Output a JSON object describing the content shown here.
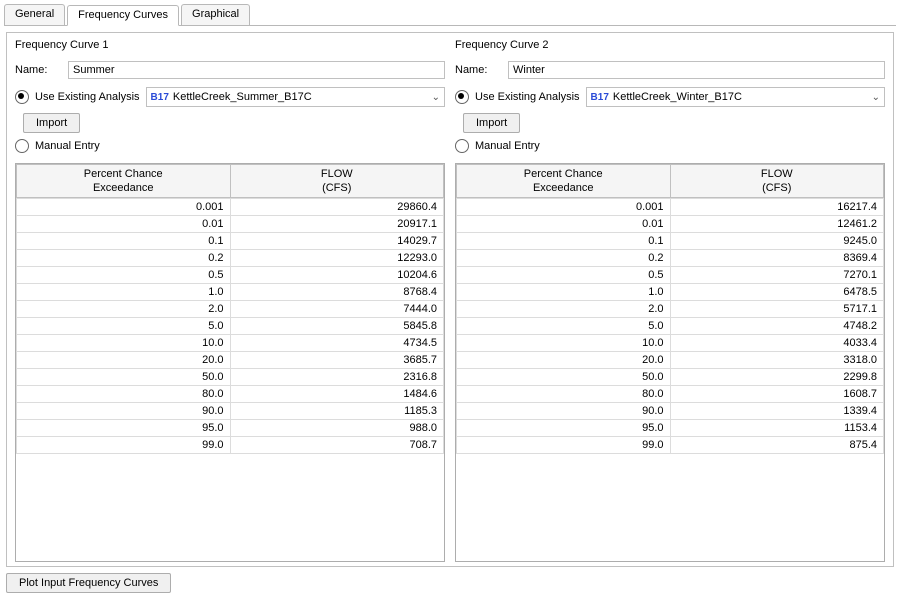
{
  "tabs": {
    "general": "General",
    "freq": "Frequency Curves",
    "graphical": "Graphical",
    "activeIndex": 1
  },
  "labels": {
    "name": "Name:",
    "use_existing": "Use Existing Analysis",
    "manual_entry": "Manual Entry",
    "import": "Import",
    "plot": "Plot Input Frequency Curves",
    "b17": "B17",
    "col_exceedance_l1": "Percent Chance",
    "col_exceedance_l2": "Exceedance",
    "col_flow_l1": "FLOW",
    "col_flow_l2": "(CFS)"
  },
  "curve1": {
    "title": "Frequency Curve 1",
    "name": "Summer",
    "analysis": "KettleCreek_Summer_B17C",
    "rows": [
      {
        "p": "0.001",
        "f": "29860.4"
      },
      {
        "p": "0.01",
        "f": "20917.1"
      },
      {
        "p": "0.1",
        "f": "14029.7"
      },
      {
        "p": "0.2",
        "f": "12293.0"
      },
      {
        "p": "0.5",
        "f": "10204.6"
      },
      {
        "p": "1.0",
        "f": "8768.4"
      },
      {
        "p": "2.0",
        "f": "7444.0"
      },
      {
        "p": "5.0",
        "f": "5845.8"
      },
      {
        "p": "10.0",
        "f": "4734.5"
      },
      {
        "p": "20.0",
        "f": "3685.7"
      },
      {
        "p": "50.0",
        "f": "2316.8"
      },
      {
        "p": "80.0",
        "f": "1484.6"
      },
      {
        "p": "90.0",
        "f": "1185.3"
      },
      {
        "p": "95.0",
        "f": "988.0"
      },
      {
        "p": "99.0",
        "f": "708.7"
      }
    ]
  },
  "curve2": {
    "title": "Frequency Curve 2",
    "name": "Winter",
    "analysis": "KettleCreek_Winter_B17C",
    "rows": [
      {
        "p": "0.001",
        "f": "16217.4"
      },
      {
        "p": "0.01",
        "f": "12461.2"
      },
      {
        "p": "0.1",
        "f": "9245.0"
      },
      {
        "p": "0.2",
        "f": "8369.4"
      },
      {
        "p": "0.5",
        "f": "7270.1"
      },
      {
        "p": "1.0",
        "f": "6478.5"
      },
      {
        "p": "2.0",
        "f": "5717.1"
      },
      {
        "p": "5.0",
        "f": "4748.2"
      },
      {
        "p": "10.0",
        "f": "4033.4"
      },
      {
        "p": "20.0",
        "f": "3318.0"
      },
      {
        "p": "50.0",
        "f": "2299.8"
      },
      {
        "p": "80.0",
        "f": "1608.7"
      },
      {
        "p": "90.0",
        "f": "1339.4"
      },
      {
        "p": "95.0",
        "f": "1153.4"
      },
      {
        "p": "99.0",
        "f": "875.4"
      }
    ]
  }
}
